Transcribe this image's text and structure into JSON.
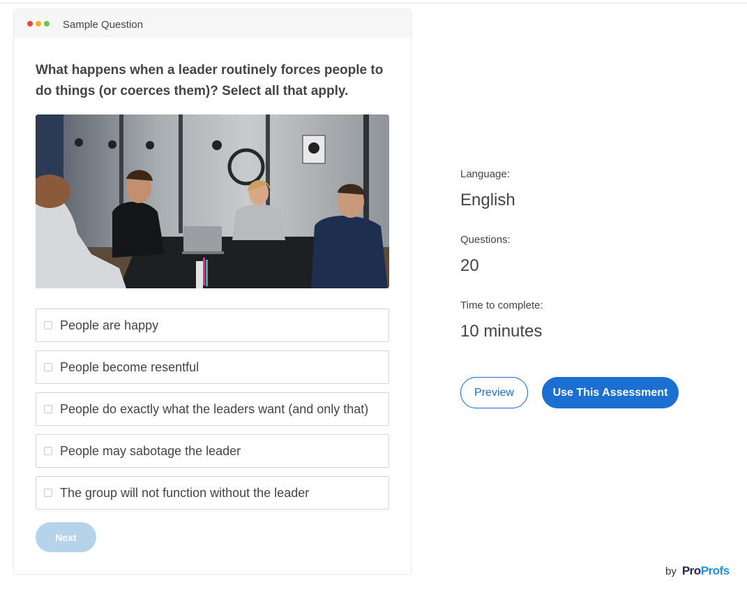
{
  "card": {
    "title": "Sample Question",
    "dot_colors": [
      "#f0433a",
      "#f5b21b",
      "#6cc644"
    ]
  },
  "question": {
    "text": "What happens when a leader routinely forces people to do things (or coerces them)? Select all that apply."
  },
  "image": {
    "description_icon": "photo-of-meeting"
  },
  "options": [
    {
      "label": "People are happy",
      "checked": false
    },
    {
      "label": "People become resentful",
      "checked": false
    },
    {
      "label": "People do exactly what the leaders want (and only that)",
      "checked": false
    },
    {
      "label": "People may sabotage the leader",
      "checked": false
    },
    {
      "label": "The group will not function without the leader",
      "checked": false
    }
  ],
  "next_button": {
    "label": "Next",
    "enabled": false
  },
  "info": {
    "language_label": "Language:",
    "language_value": "English",
    "questions_label": "Questions:",
    "questions_value": "20",
    "time_label": "Time to complete:",
    "time_value": "10 minutes"
  },
  "actions": {
    "preview_label": "Preview",
    "use_label": "Use This Assessment"
  },
  "brand": {
    "by": "by",
    "logo_part1": "Pro",
    "logo_part2": "Profs"
  },
  "colors": {
    "accent": "#1a6fd1",
    "disabled_button": "#b5d4ec",
    "brand_light": "#1a8fe3",
    "brand_dark": "#1b2a4e"
  }
}
